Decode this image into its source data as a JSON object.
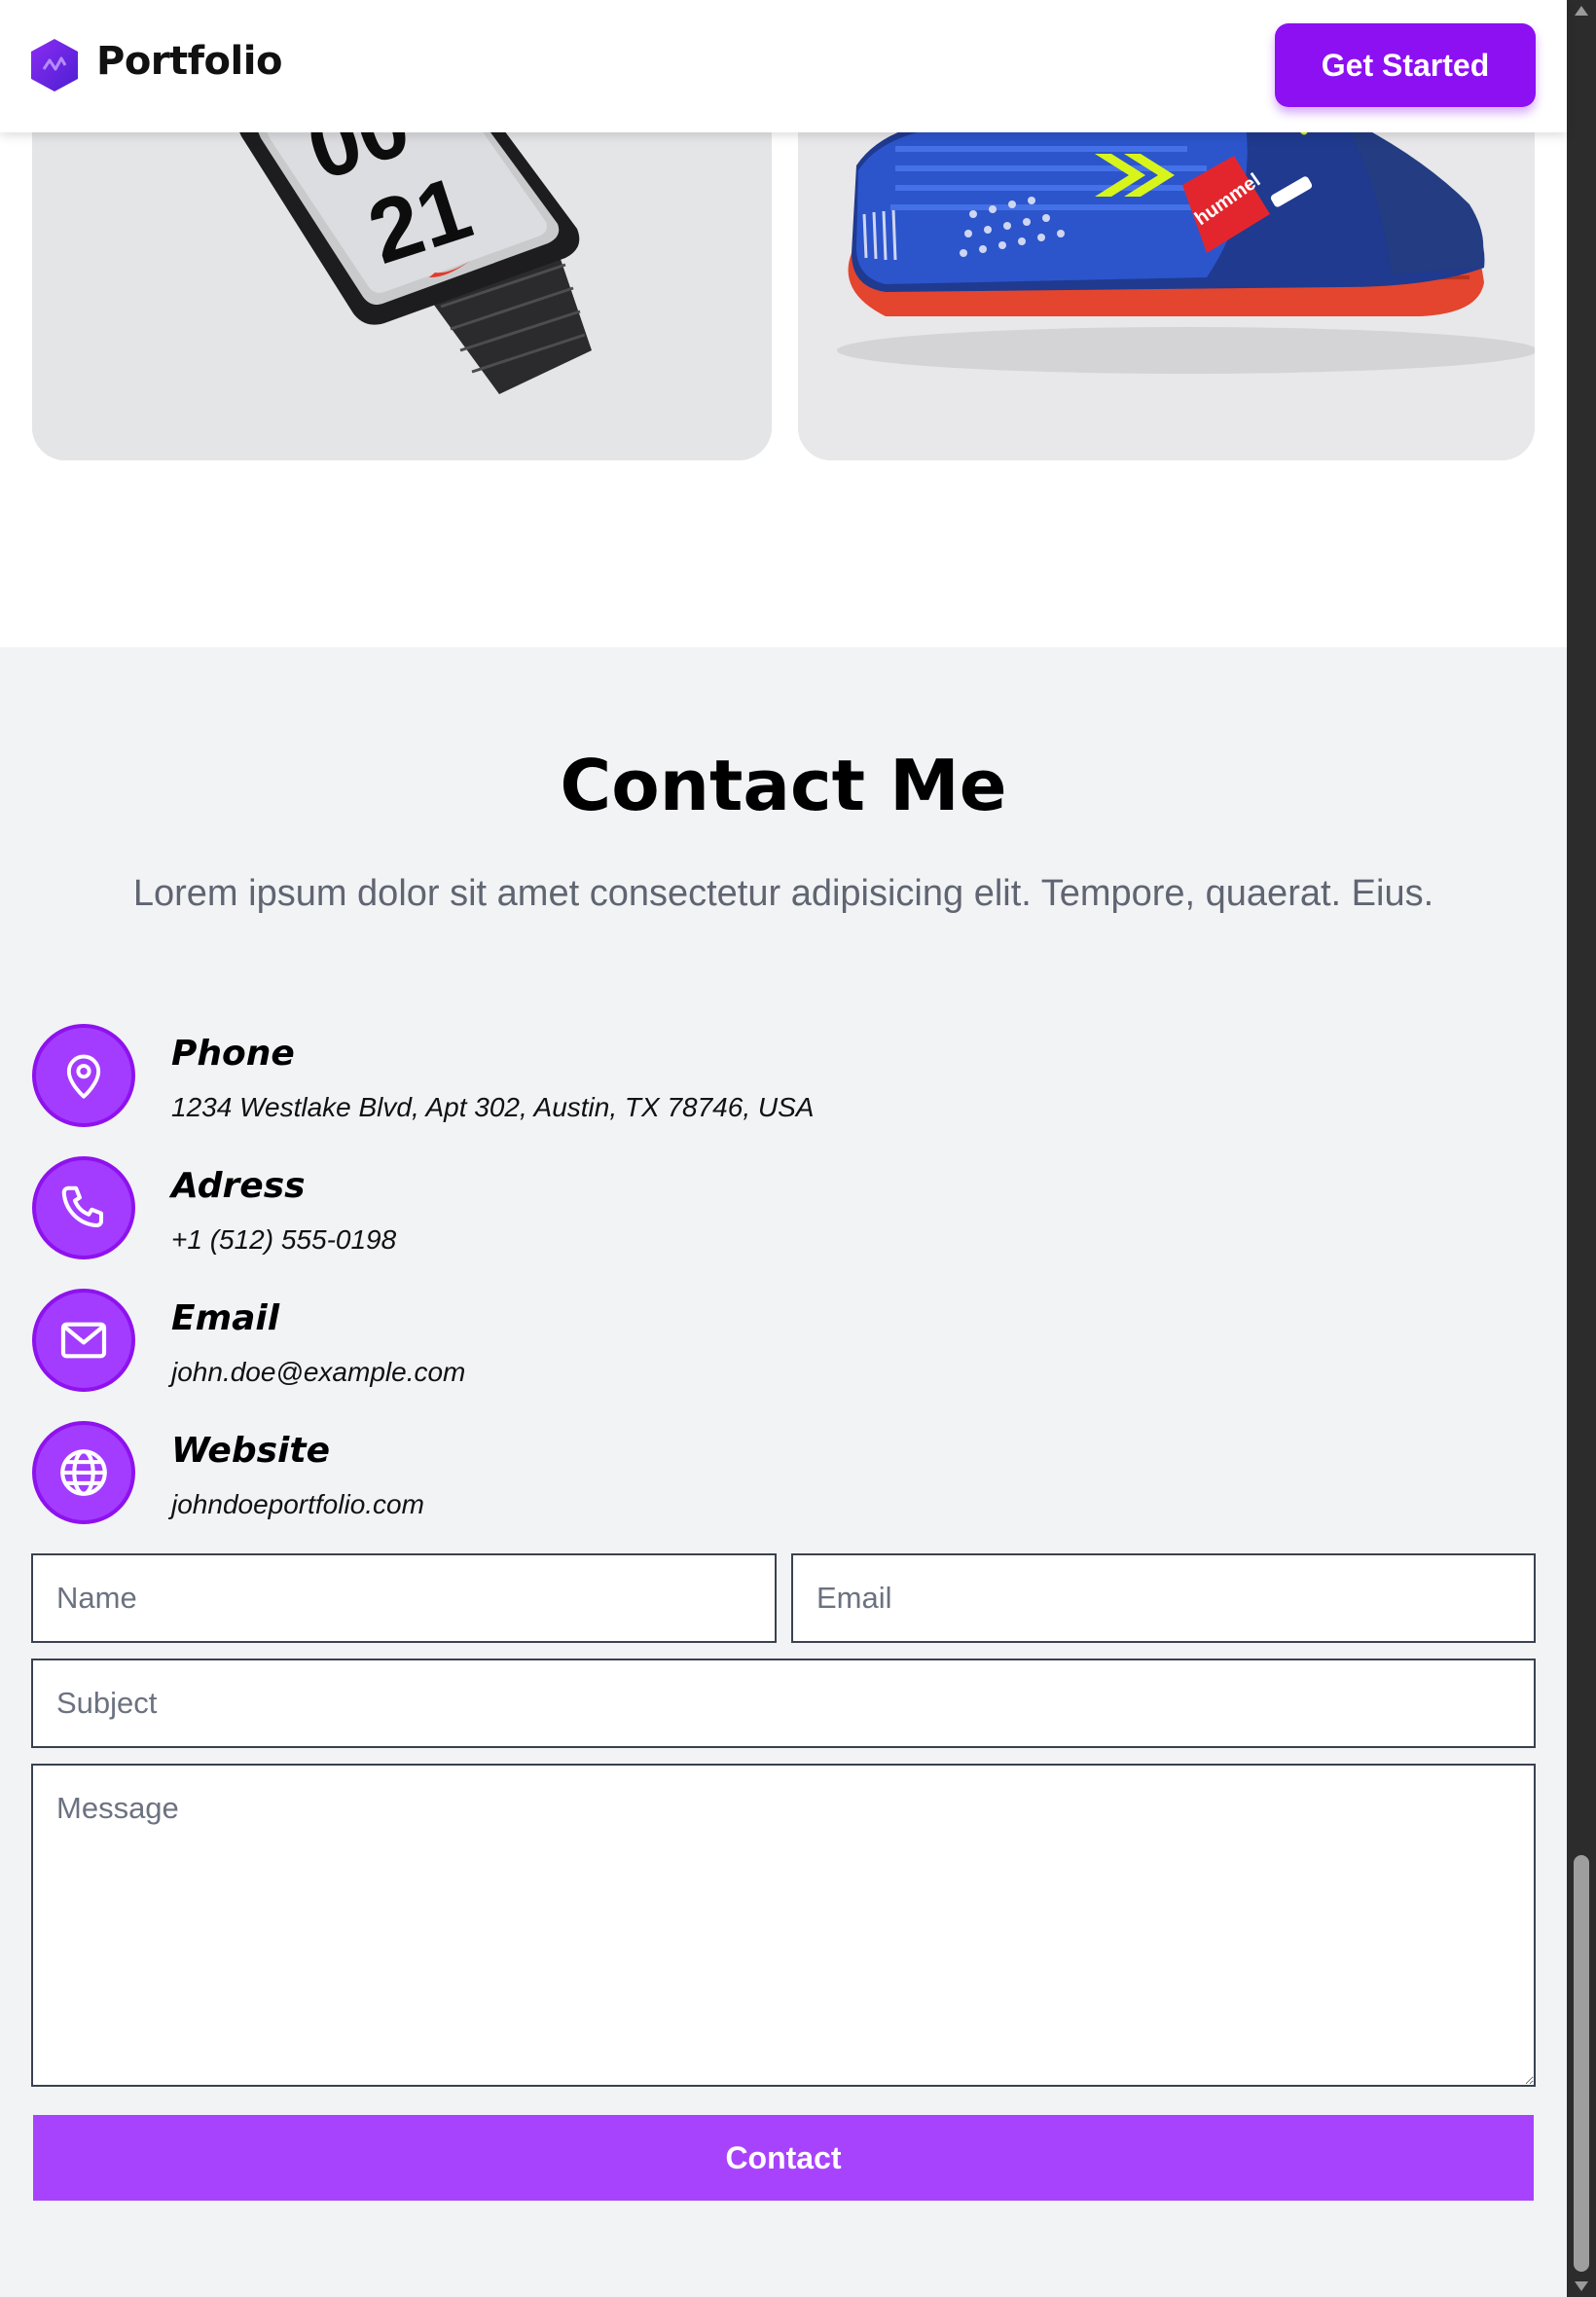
{
  "header": {
    "brand": "Portfolio",
    "cta_label": "Get Started",
    "logo_icon": "hexagon-logo-icon"
  },
  "gallery": {
    "items": [
      {
        "subject": "smartwatch-image",
        "watch_face_text": "21"
      },
      {
        "subject": "sneaker-image",
        "brand_text": "hummel"
      }
    ]
  },
  "contact": {
    "title": "Contact Me",
    "subtitle": "Lorem ipsum dolor sit amet consectetur adipisicing elit. Tempore, quaerat. Eius.",
    "info": [
      {
        "icon": "location-pin-icon",
        "label": "Phone",
        "value": "1234 Westlake Blvd, Apt 302, Austin, TX 78746, USA"
      },
      {
        "icon": "phone-icon",
        "label": "Adress",
        "value": "+1 (512) 555-0198"
      },
      {
        "icon": "mail-icon",
        "label": "Email",
        "value": "john.doe@example.com"
      },
      {
        "icon": "globe-icon",
        "label": "Website",
        "value": "johndoeportfolio.com"
      }
    ],
    "form": {
      "name_placeholder": "Name",
      "email_placeholder": "Email",
      "subject_placeholder": "Subject",
      "message_placeholder": "Message",
      "submit_label": "Contact"
    }
  },
  "colors": {
    "accent": "#8c10f2",
    "icon_circle": "#a33cff",
    "submit": "#a843fd",
    "section_bg": "#f2f3f5"
  }
}
